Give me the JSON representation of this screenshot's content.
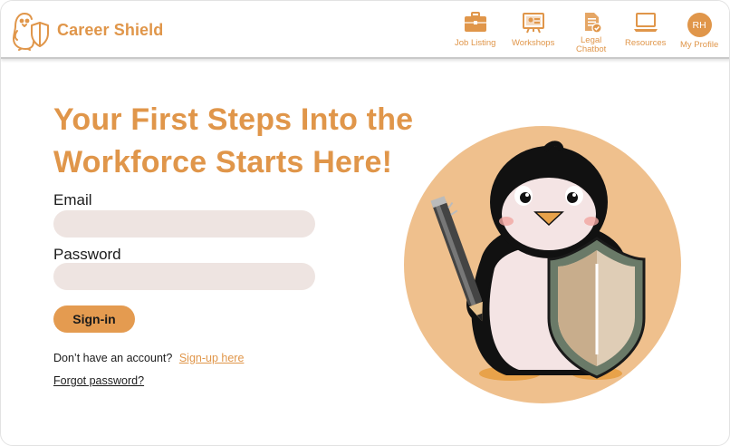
{
  "app": {
    "name": "Career Shield"
  },
  "nav": {
    "items": [
      {
        "label": "Job Listing",
        "icon": "briefcase-icon"
      },
      {
        "label": "Workshops",
        "icon": "presentation-board-icon"
      },
      {
        "label_line1": "Legal",
        "label_line2": "Chatbot",
        "icon": "document-check-icon"
      },
      {
        "label": "Resources",
        "icon": "laptop-icon"
      },
      {
        "label": "My Profile",
        "initials": "RH",
        "icon": "avatar-icon"
      }
    ]
  },
  "hero": {
    "headline_line1": "Your First Steps Into the",
    "headline_line2": "Workforce Starts Here!"
  },
  "form": {
    "email_label": "Email",
    "email_value": "",
    "password_label": "Password",
    "password_value": "",
    "signin_label": "Sign-in",
    "signup_prompt": "Don’t have an account?",
    "signup_link": "Sign-up here",
    "forgot_link": "Forgot password?"
  },
  "colors": {
    "accent": "#e0964a",
    "button": "#e49b50",
    "field_bg": "#eee4e1",
    "illustration_circle": "#efc08d"
  }
}
